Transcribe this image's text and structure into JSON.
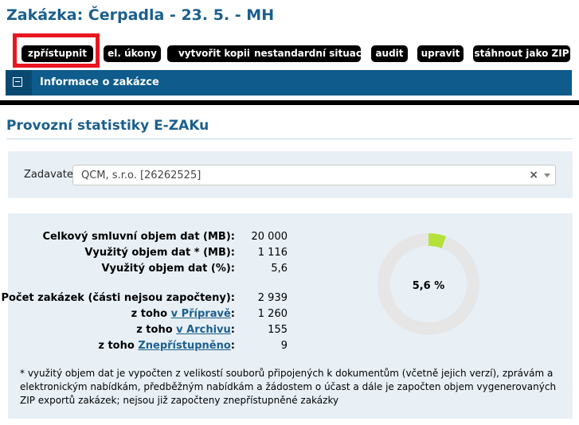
{
  "page": {
    "title": "Zakázka: Čerpadla - 23. 5. - MH"
  },
  "toolbar": {
    "buttons": [
      "zpřístupnit",
      "el. úkony",
      "vytvořit kopii",
      "nestandardní situace",
      "audit",
      "upravit",
      "stáhnout jako ZIP"
    ]
  },
  "info_panel": {
    "title": "Informace o zakázce"
  },
  "stats": {
    "section_title": "Provozní statistiky E-ZAKu",
    "filter": {
      "label": "Zadavatel:",
      "value": "QCM, s.r.o. [26262525]",
      "clear_icon": "×"
    },
    "rows": [
      {
        "label": "Celkový smluvní objem dat (MB):",
        "value": "20 000"
      },
      {
        "label": "Využitý objem dat * (MB):",
        "value": "1 116"
      },
      {
        "label": "Využitý objem dat (%):",
        "value": "5,6"
      },
      {
        "label": "Počet zakázek (části nejsou započteny):",
        "value": "2 939"
      },
      {
        "label_prefix": "z toho",
        "label_link": "v Přípravě",
        "label_suffix": ":",
        "value": "1 260"
      },
      {
        "label_prefix": "z toho",
        "label_link": "v Archivu",
        "label_suffix": ":",
        "value": "155"
      },
      {
        "label_prefix": "z toho",
        "label_link": "Znepřístupněno",
        "label_suffix": ":",
        "value": "9"
      }
    ],
    "donut": {
      "percent_label": "5,6 %",
      "fraction": 0.056,
      "color_used": "#b5e23a",
      "color_rest": "#e6e6e6"
    },
    "footnote": "* využitý objem dat je vypočten z velikostí souborů připojených k dokumentům (včetně jejich verzí), zprávám a elektronickým nabídkám, předběžným nabídkám a žádostem o účast a dále je započten objem vygenerovaných ZIP exportů zakázek; nejsou již započteny znepřístupněné zakázky"
  }
}
